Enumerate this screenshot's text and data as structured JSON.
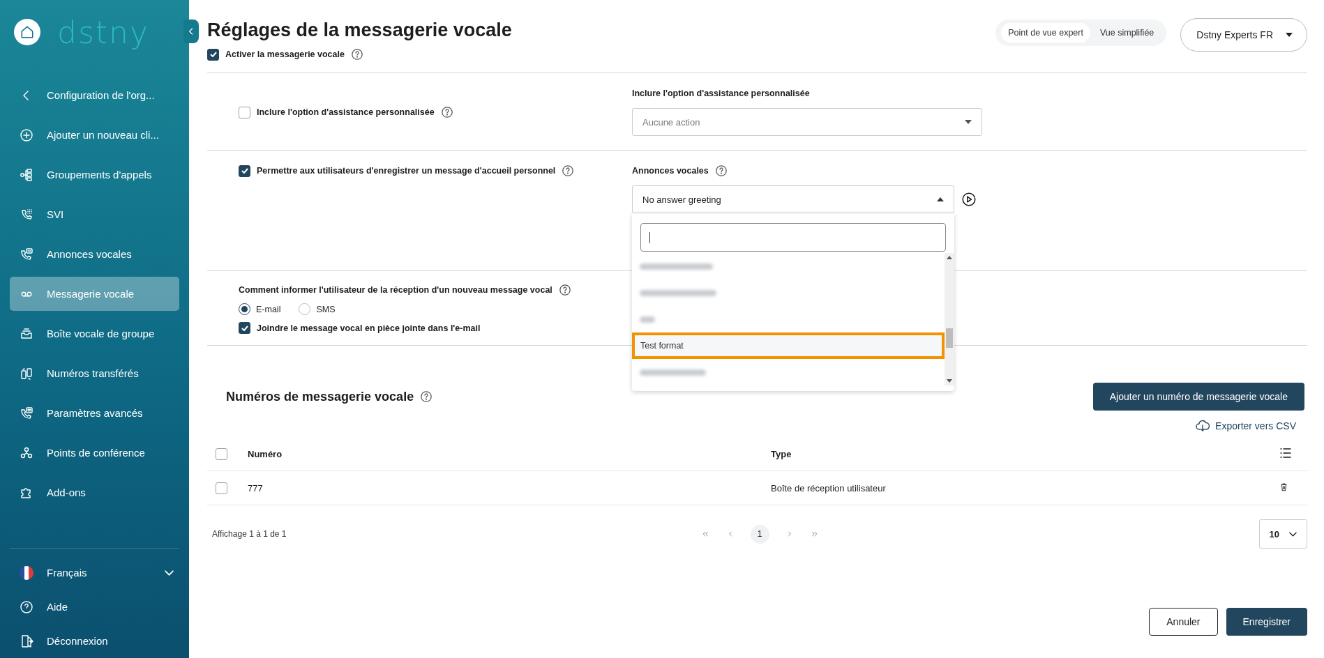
{
  "sidebar": {
    "logo": "dstny",
    "back": "Configuration de l'org...",
    "items": [
      {
        "label": "Ajouter un nouveau cli...",
        "selected": false
      },
      {
        "label": "Groupements d'appels",
        "selected": false
      },
      {
        "label": "SVI",
        "selected": false
      },
      {
        "label": "Annonces vocales",
        "selected": false
      },
      {
        "label": "Messagerie vocale",
        "selected": true
      },
      {
        "label": "Boîte vocale de groupe",
        "selected": false
      },
      {
        "label": "Numéros transférés",
        "selected": false
      },
      {
        "label": "Paramètres avancés",
        "selected": false
      },
      {
        "label": "Points de conférence",
        "selected": false
      },
      {
        "label": "Add-ons",
        "selected": false
      }
    ],
    "language": "Français",
    "help": "Aide",
    "logout": "Déconnexion"
  },
  "header": {
    "title": "Réglages de la messagerie vocale",
    "enable": {
      "label": "Activer la messagerie vocale",
      "checked": true
    }
  },
  "view_toggle": [
    {
      "label": "Point de vue expert",
      "selected": true
    },
    {
      "label": "Vue simplifiée",
      "selected": false
    }
  ],
  "account_menu": {
    "label": "Dstny Experts FR"
  },
  "assistance": {
    "checkbox": {
      "label": "Inclure l'option d'assistance personnalisée",
      "checked": false
    },
    "field_label": "Inclure l'option d'assistance personnalisée",
    "select": {
      "placeholder": "Aucune action"
    }
  },
  "greeting": {
    "checkbox": {
      "label": "Permettre aux utilisateurs d'enregistrer un message d'accueil personnel",
      "checked": true
    },
    "field_label": "Annonces vocales",
    "select": {
      "value": "No answer greeting",
      "expanded": true
    },
    "options": [
      {
        "kind": "blurred"
      },
      {
        "kind": "blurred"
      },
      {
        "kind": "blurred"
      },
      {
        "kind": "text",
        "label": "Test format",
        "highlighted": true
      },
      {
        "kind": "blurred"
      }
    ]
  },
  "notification": {
    "label": "Comment informer l'utilisateur de la réception d'un nouveau message vocal",
    "radios": [
      {
        "label": "E-mail",
        "selected": true
      },
      {
        "label": "SMS",
        "selected": false
      }
    ],
    "attach": {
      "label": "Joindre le message vocal en pièce jointe dans l'e-mail",
      "checked": true
    }
  },
  "numbers": {
    "title": "Numéros de messagerie vocale",
    "add_button": "Ajouter un numéro de messagerie vocale",
    "export": "Exporter vers CSV",
    "select_all": {
      "checked": false
    },
    "columns": [
      "Numéro",
      "Type"
    ],
    "rows": [
      {
        "checked": false,
        "cells": [
          "777",
          "Boîte de réception utilisateur"
        ]
      }
    ],
    "summary": "Affichage 1 à 1 de 1",
    "pages": [
      {
        "label": "1",
        "selected": true
      }
    ],
    "page_size": "10"
  },
  "footer": {
    "buttons": [
      {
        "label": "Annuler",
        "kind": "secondary"
      },
      {
        "label": "Enregistrer",
        "kind": "primary"
      }
    ]
  }
}
